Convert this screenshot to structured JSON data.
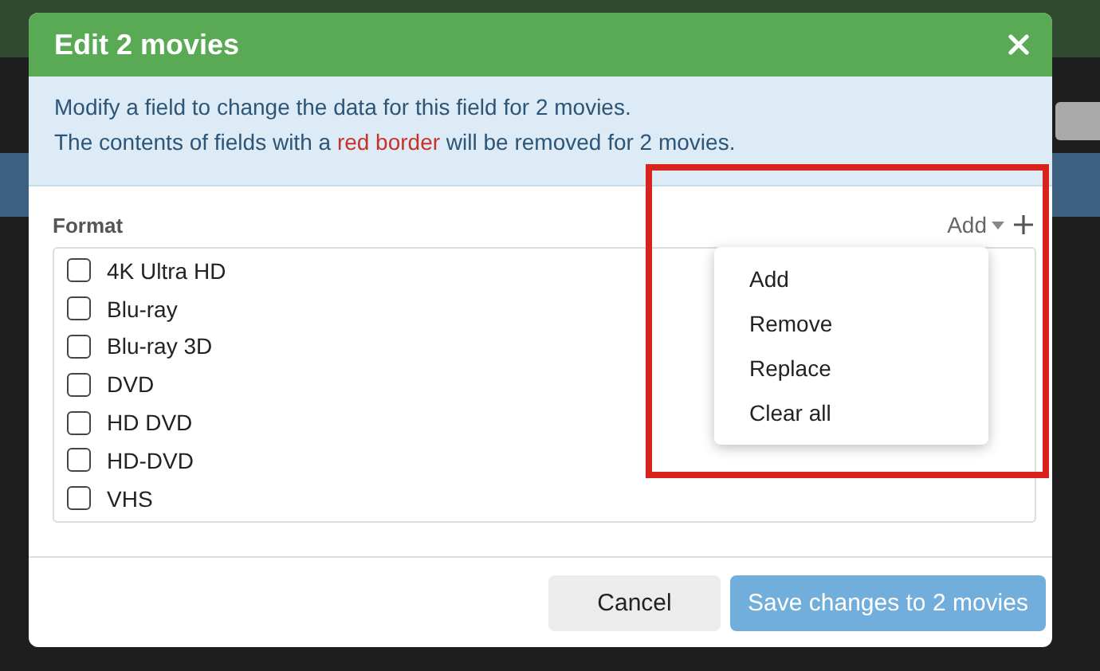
{
  "dialog": {
    "title": "Edit 2 movies",
    "info": {
      "line_1": "Modify a field to change the data for this field for 2 movies.",
      "line_2": "The contents of fields with a **red border** will be removed for 2 movies."
    },
    "field": {
      "label": "Format",
      "mode_button": "Add",
      "options": [
        {
          "label": "4K Ultra HD",
          "checked": false
        },
        {
          "label": "Blu-ray",
          "checked": false
        },
        {
          "label": "Blu-ray 3D",
          "checked": false
        },
        {
          "label": "DVD",
          "checked": false
        },
        {
          "label": "HD DVD",
          "checked": false
        },
        {
          "label": "HD-DVD",
          "checked": false
        },
        {
          "label": "VHS",
          "checked": false
        }
      ]
    },
    "menu": [
      "Add",
      "Remove",
      "Replace",
      "Clear all"
    ],
    "buttons": {
      "cancel": "Cancel",
      "save": "Save changes to 2 movies"
    }
  }
}
